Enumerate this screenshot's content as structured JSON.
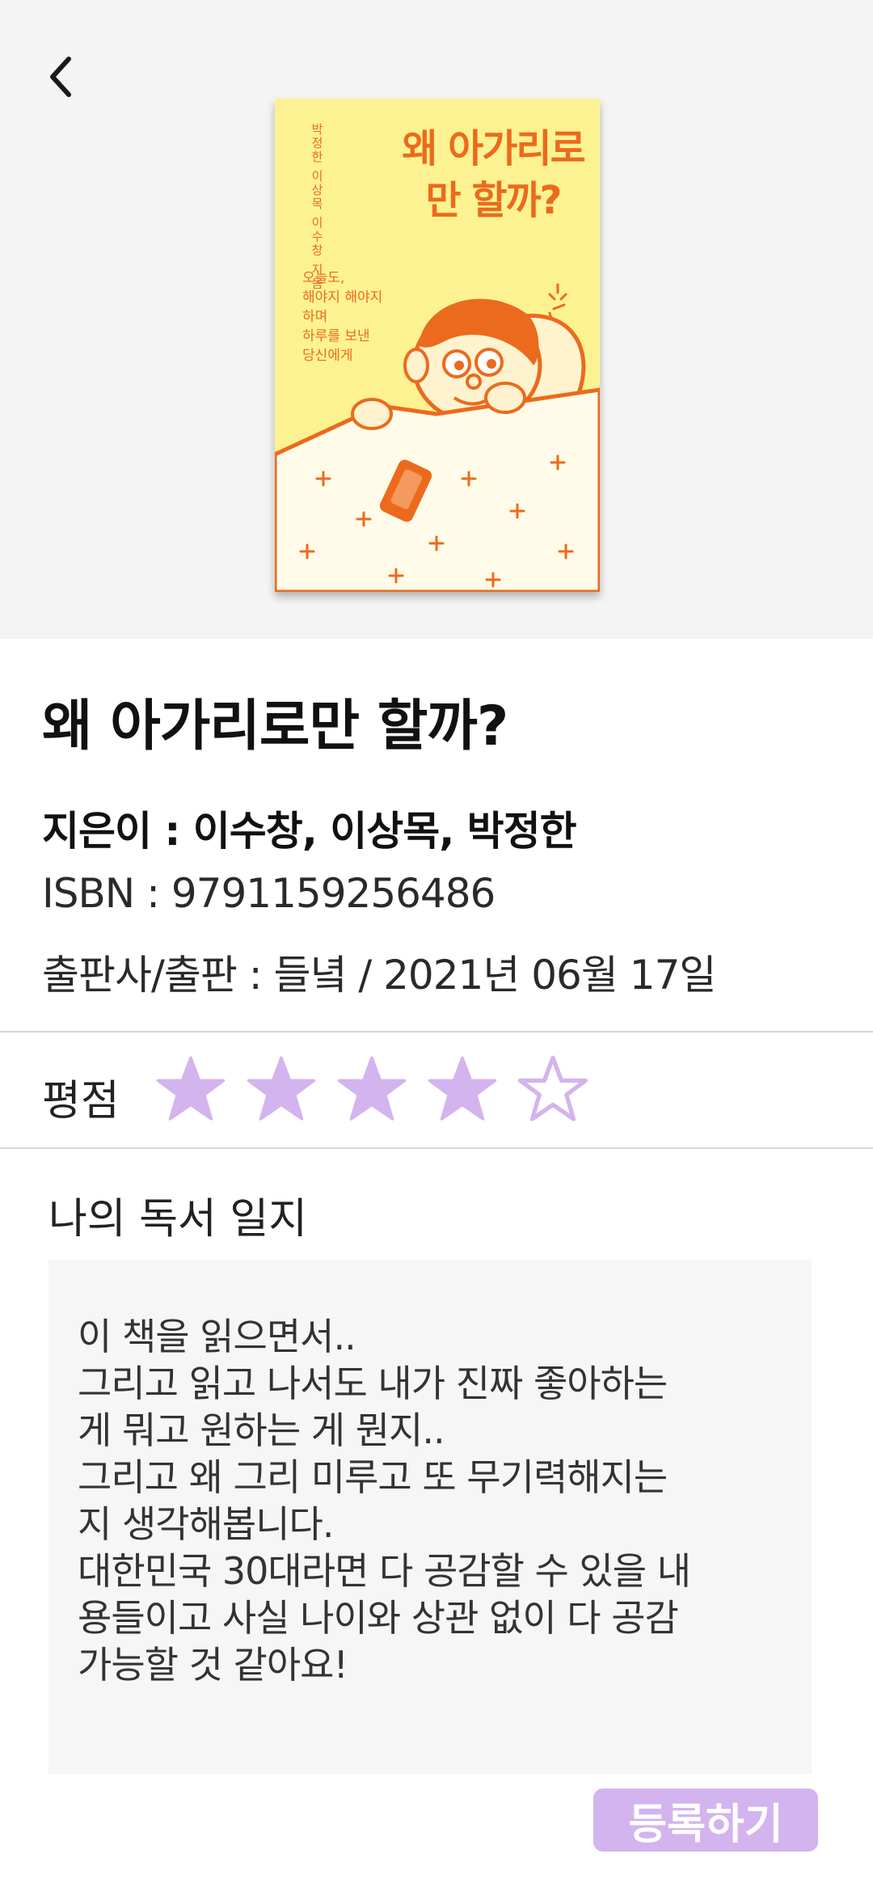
{
  "book": {
    "title": "왜 아가리로만 할까?",
    "authors_line": "지은이 : 이수창, 이상목, 박정한",
    "isbn_line": "ISBN : 9791159256486",
    "publisher_line": "출판사/출판 : 들녘 / 2021년 06월 17일"
  },
  "cover": {
    "title": "왜 아가리로만 할까?",
    "authors": "박정한 이상목 이수창 지음",
    "tagline": "오늘도,\n해야지 해야지\n하며\n하루를 보낸\n당신에게",
    "background_color": "#fdf291",
    "accent_color": "#ec6a1d"
  },
  "nav": {
    "back_icon": "chevron-left-icon"
  },
  "rating": {
    "label": "평점",
    "value": 4,
    "max": 5,
    "color": "#d3b4ee"
  },
  "journal": {
    "label": "나의 독서 일지",
    "text": "이 책을 읽으면서..\n그리고 읽고 나서도 내가 진짜 좋아하는\n게 뭐고 원하는 게 뭔지..\n그리고 왜 그리 미루고 또 무기력해지는\n지 생각해봅니다.\n대한민국 30대라면 다 공감할 수 있을 내\n용들이고 사실 나이와 상관 없이 다 공감\n가능할 것 같아요!"
  },
  "submit": {
    "label": "등록하기",
    "color": "#d3b4ee"
  }
}
